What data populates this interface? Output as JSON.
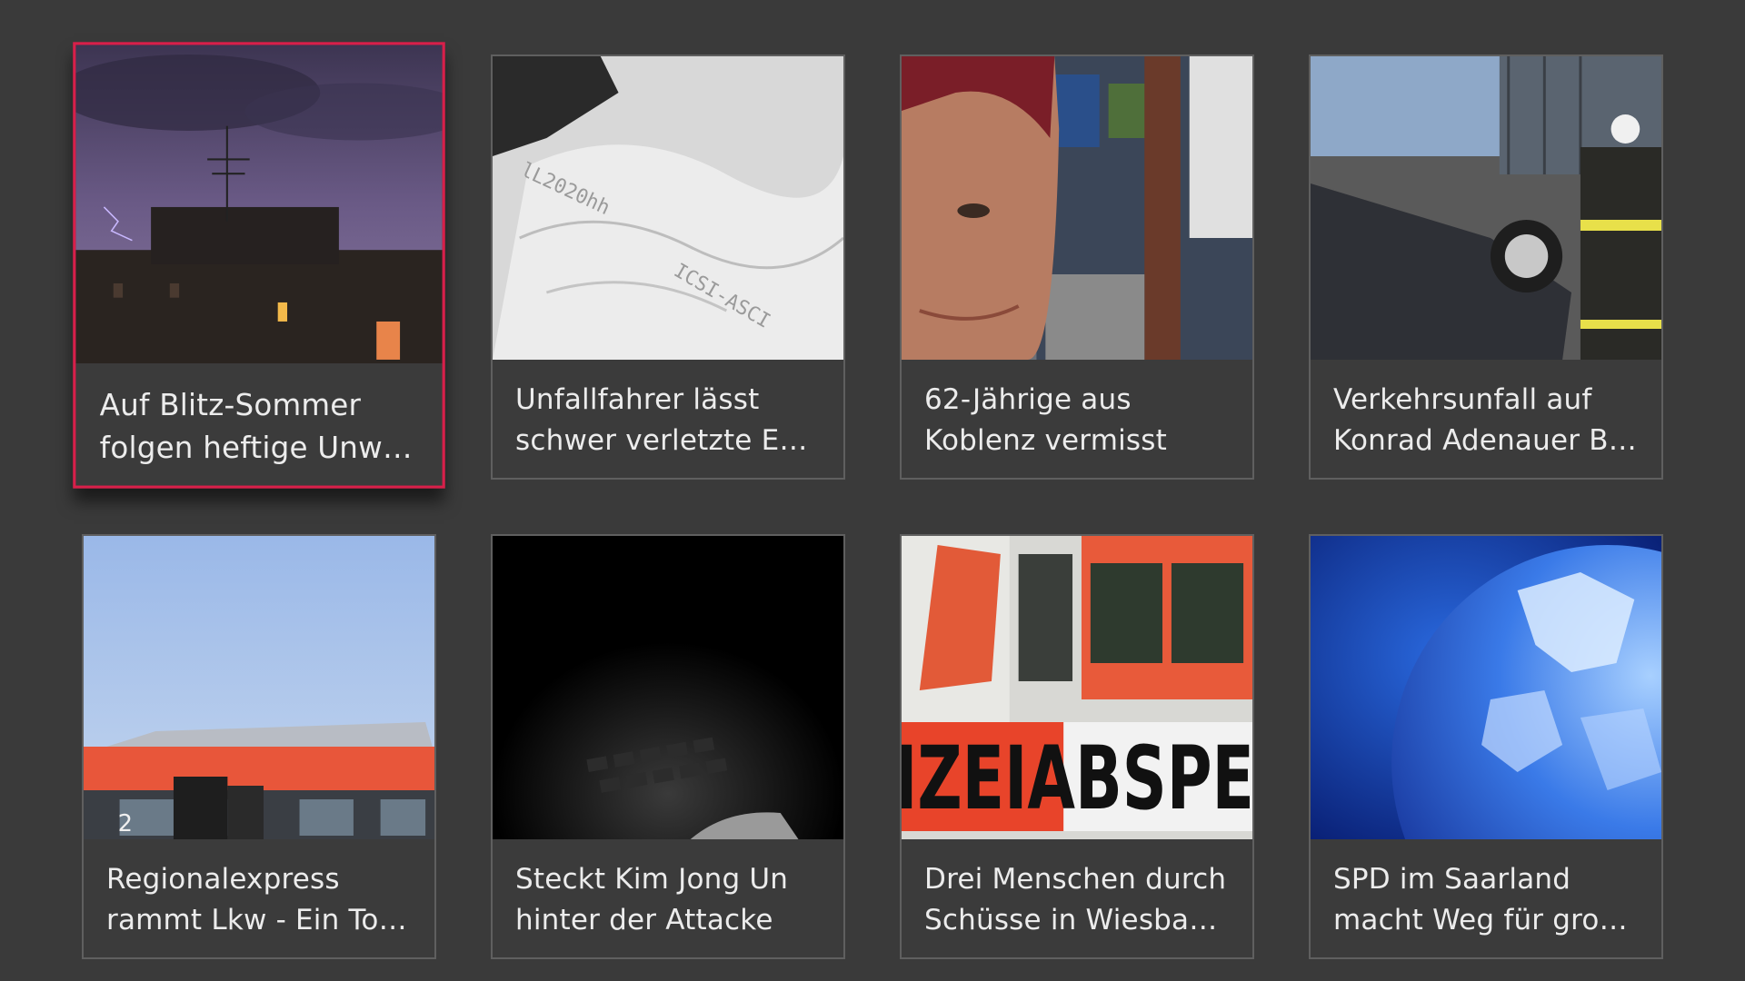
{
  "articles": [
    {
      "line1": "Auf Blitz-Sommer",
      "line2": "folgen heftige Unwe…",
      "image": "storm-building-image",
      "focused": true
    },
    {
      "line1": "Unfallfahrer lässt",
      "line2": "schwer verletzte Eh…",
      "image": "airbag-image",
      "focused": false
    },
    {
      "line1": "62-Jährige aus",
      "line2": "Koblenz vermisst",
      "image": "woman-portrait-image",
      "focused": false
    },
    {
      "line1": "Verkehrsunfall auf",
      "line2": "Konrad Adenauer B…",
      "image": "overturned-car-image",
      "focused": false
    },
    {
      "line1": "Regionalexpress",
      "line2": "rammt Lkw - Ein Tot…",
      "image": "train-image",
      "focused": false
    },
    {
      "line1": "Steckt Kim Jong Un",
      "line2": "hinter der Attacke",
      "image": "dark-keyboard-image",
      "focused": false
    },
    {
      "line1": "Drei Menschen durch",
      "line2": "Schüsse in Wiesbad…",
      "image": "police-tape-image",
      "focused": false
    },
    {
      "line1": "SPD im Saarland",
      "line2": "macht Weg für groß…",
      "image": "globe-image",
      "focused": false
    }
  ],
  "tape_text": "IZEIABSPE",
  "colors": {
    "background": "#3a3a3a",
    "card_border": "#5f5f5f",
    "focus_border": "#d81f4a",
    "title_text": "#ececec"
  }
}
